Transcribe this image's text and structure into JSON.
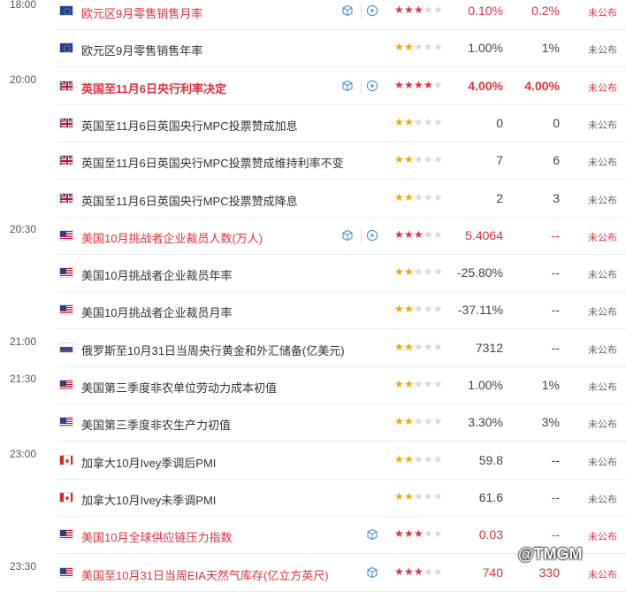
{
  "rows": [
    {
      "time": "18:00",
      "flag": "eu",
      "name": "欧元区9月零售销售月率",
      "stars": 3,
      "prev": "0.10%",
      "actual": "0.2%",
      "status": "未公布",
      "highlight": true,
      "bold": false,
      "icons": [
        "cube",
        "play"
      ]
    },
    {
      "time": "",
      "flag": "eu",
      "name": "欧元区9月零售销售年率",
      "stars": 2,
      "prev": "1.00%",
      "actual": "1%",
      "status": "未公布",
      "highlight": false,
      "bold": false,
      "icons": []
    },
    {
      "time": "20:00",
      "flag": "uk",
      "name": "英国至11月6日央行利率决定",
      "stars": 4,
      "prev": "4.00%",
      "actual": "4.00%",
      "status": "未公布",
      "highlight": true,
      "bold": true,
      "icons": [
        "cube",
        "play"
      ]
    },
    {
      "time": "",
      "flag": "uk",
      "name": "英国至11月6日英国央行MPC投票赞成加息",
      "stars": 2,
      "prev": "0",
      "actual": "0",
      "status": "未公布",
      "highlight": false,
      "bold": false,
      "icons": []
    },
    {
      "time": "",
      "flag": "uk",
      "name": "英国至11月6日英国央行MPC投票赞成维持利率不变",
      "stars": 2,
      "prev": "7",
      "actual": "6",
      "status": "未公布",
      "highlight": false,
      "bold": false,
      "icons": []
    },
    {
      "time": "",
      "flag": "uk",
      "name": "英国至11月6日英国央行MPC投票赞成降息",
      "stars": 2,
      "prev": "2",
      "actual": "3",
      "status": "未公布",
      "highlight": false,
      "bold": false,
      "icons": []
    },
    {
      "time": "20:30",
      "flag": "us",
      "name": "美国10月挑战者企业裁员人数(万人)",
      "stars": 3,
      "prev": "5.4064",
      "actual": "--",
      "status": "未公布",
      "highlight": true,
      "bold": false,
      "icons": [
        "cube",
        "play"
      ]
    },
    {
      "time": "",
      "flag": "us",
      "name": "美国10月挑战者企业裁员年率",
      "stars": 2,
      "prev": "-25.80%",
      "actual": "--",
      "status": "未公布",
      "highlight": false,
      "bold": false,
      "icons": []
    },
    {
      "time": "",
      "flag": "us",
      "name": "美国10月挑战者企业裁员月率",
      "stars": 2,
      "prev": "-37.11%",
      "actual": "--",
      "status": "未公布",
      "highlight": false,
      "bold": false,
      "icons": []
    },
    {
      "time": "21:00",
      "flag": "ru",
      "name": "俄罗斯至10月31日当周央行黄金和外汇储备(亿美元)",
      "stars": 2,
      "prev": "7312",
      "actual": "--",
      "status": "未公布",
      "highlight": false,
      "bold": false,
      "icons": []
    },
    {
      "time": "21:30",
      "flag": "us",
      "name": "美国第三季度非农单位劳动力成本初值",
      "stars": 2,
      "prev": "1.00%",
      "actual": "1%",
      "status": "未公布",
      "highlight": false,
      "bold": false,
      "icons": []
    },
    {
      "time": "",
      "flag": "us",
      "name": "美国第三季度非农生产力初值",
      "stars": 2,
      "prev": "3.30%",
      "actual": "3%",
      "status": "未公布",
      "highlight": false,
      "bold": false,
      "icons": []
    },
    {
      "time": "23:00",
      "flag": "ca",
      "name": "加拿大10月Ivey季调后PMI",
      "stars": 2,
      "prev": "59.8",
      "actual": "--",
      "status": "未公布",
      "highlight": false,
      "bold": false,
      "icons": []
    },
    {
      "time": "",
      "flag": "ca",
      "name": "加拿大10月Ivey未季调PMI",
      "stars": 2,
      "prev": "61.6",
      "actual": "--",
      "status": "未公布",
      "highlight": false,
      "bold": false,
      "icons": []
    },
    {
      "time": "",
      "flag": "us",
      "name": "美国10月全球供应链压力指数",
      "stars": 3,
      "prev": "0.03",
      "actual": "--",
      "status": "未公布",
      "highlight": true,
      "bold": false,
      "icons": [
        "cube"
      ]
    },
    {
      "time": "23:30",
      "flag": "us",
      "name": "美国至10月31日当周EIA天然气库存(亿立方英尺)",
      "stars": 3,
      "prev": "740",
      "actual": "330",
      "status": "未公布",
      "highlight": true,
      "bold": false,
      "icons": [
        "cube"
      ]
    }
  ],
  "watermark": "@TMGM",
  "colors": {
    "highlight": "#e0303d",
    "star": "#f1a500",
    "icon": "#4a8fd6"
  }
}
